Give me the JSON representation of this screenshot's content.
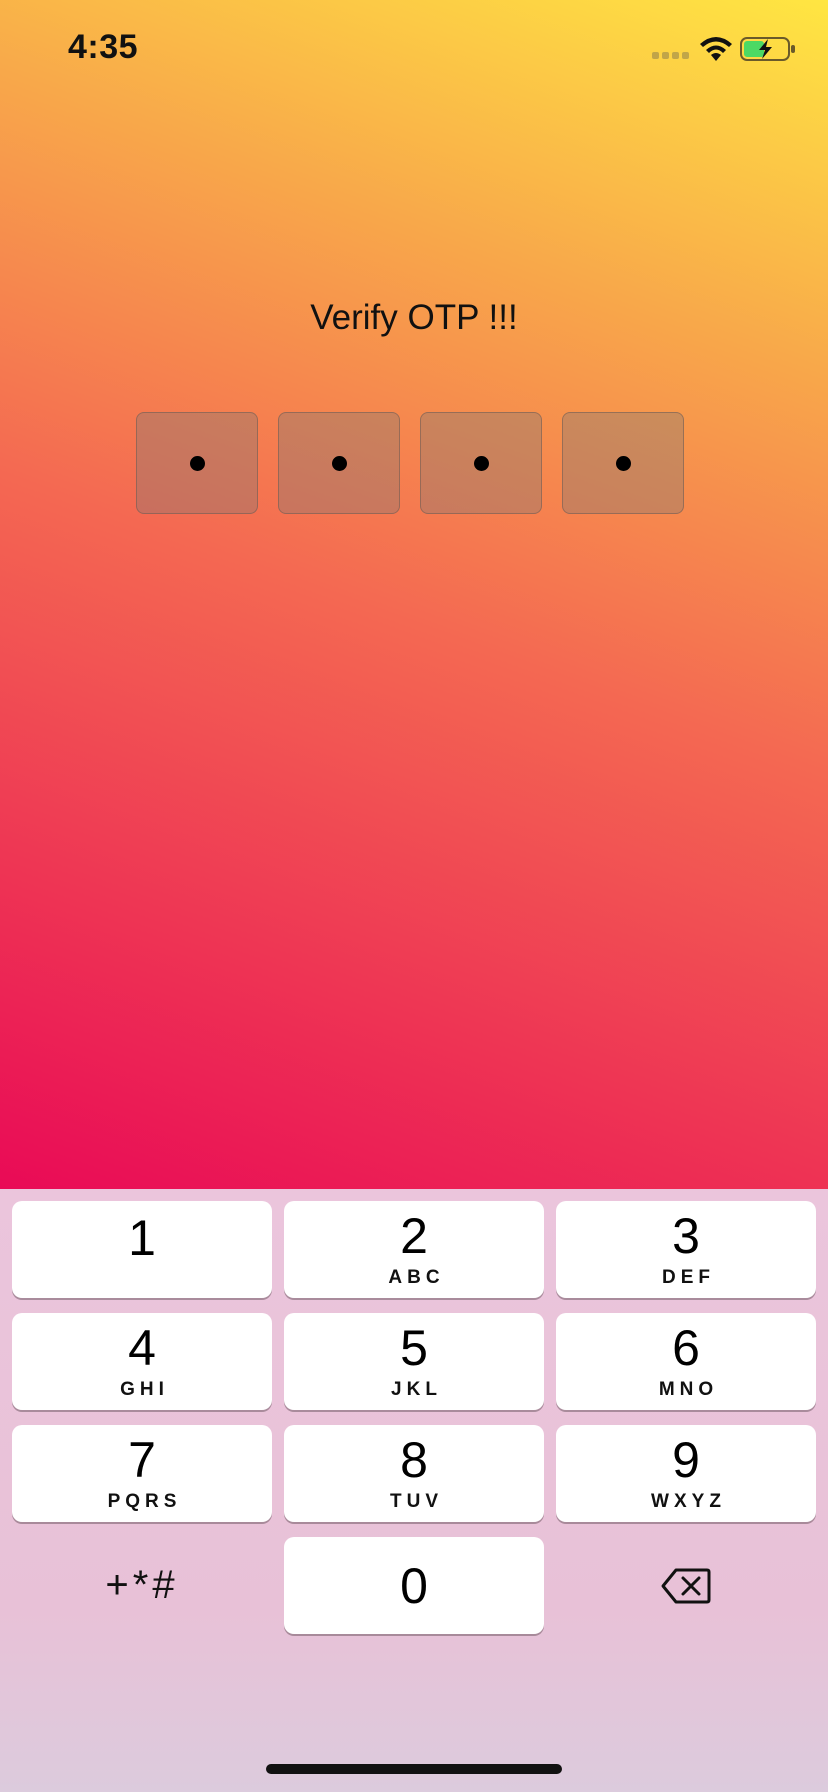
{
  "status_bar": {
    "time": "4:35",
    "signal_icon": "signal-icon",
    "wifi_icon": "wifi-icon",
    "battery_icon": "battery-charging-icon"
  },
  "title": "Verify OTP !!!",
  "otp": {
    "digits": [
      "•",
      "•",
      "•",
      "•"
    ]
  },
  "keypad": {
    "keys": [
      {
        "num": "1",
        "letters": ""
      },
      {
        "num": "2",
        "letters": "ABC"
      },
      {
        "num": "3",
        "letters": "DEF"
      },
      {
        "num": "4",
        "letters": "GHI"
      },
      {
        "num": "5",
        "letters": "JKL"
      },
      {
        "num": "6",
        "letters": "MNO"
      },
      {
        "num": "7",
        "letters": "PQRS"
      },
      {
        "num": "8",
        "letters": "TUV"
      },
      {
        "num": "9",
        "letters": "WXYZ"
      },
      {
        "num": "0",
        "letters": ""
      }
    ],
    "symbols_label": "+*#",
    "delete_icon": "backspace-icon"
  },
  "colors": {
    "gradient_top": "#ffe642",
    "gradient_mid": "#f46852",
    "gradient_bottom": "#e90a56",
    "keyboard_bg": "#e8c1d7"
  }
}
